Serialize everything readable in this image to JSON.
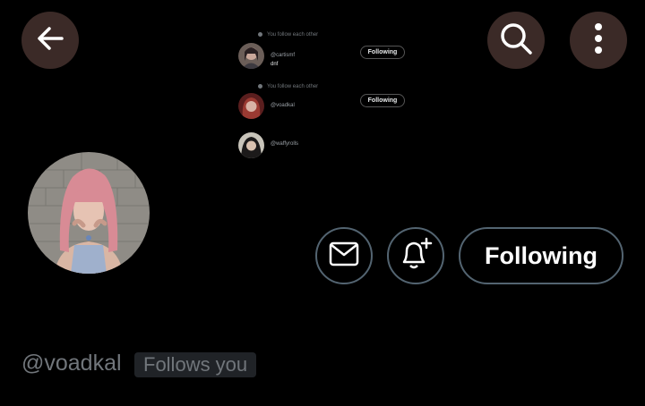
{
  "header": {
    "back_icon": "arrow-left-icon",
    "search_icon": "search-icon",
    "more_icon": "more-vertical-icon",
    "button_bg": "#3b2a27"
  },
  "banner": {
    "rows": [
      {
        "note": "You follow each other",
        "handle": "@cartismf",
        "sub": "dnf",
        "button": "Following"
      },
      {
        "note": "You follow each other",
        "handle": "@voadkal",
        "sub": "",
        "button": "Following"
      },
      {
        "note": "",
        "handle": "@waffyrolls",
        "sub": "",
        "button": ""
      }
    ]
  },
  "profile": {
    "handle": "@voadkal",
    "follows_badge": "Follows you",
    "following_label": "Following",
    "message_icon": "mail-icon",
    "notify_icon": "bell-plus-icon"
  },
  "colors": {
    "background": "#000000",
    "border": "#536471",
    "muted_text": "#71767b"
  }
}
